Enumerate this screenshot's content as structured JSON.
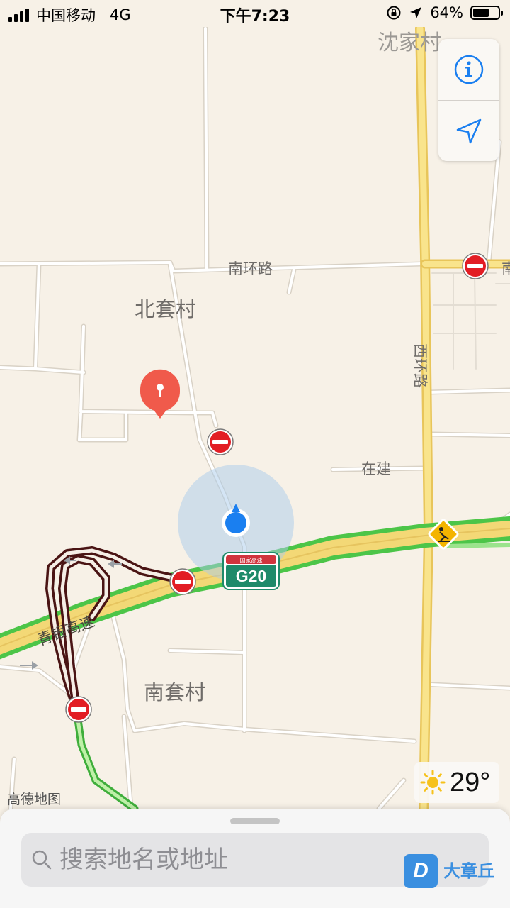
{
  "status_bar": {
    "carrier": "中国移动",
    "network": "4G",
    "time": "下午7:23",
    "battery_percent": "64%",
    "battery_level": 0.64
  },
  "map": {
    "labels": {
      "village_shenjia": "沈家村",
      "nanhuan_road": "南环路",
      "road_edge": "南",
      "village_beitao": "北套村",
      "xihuan_road": "西环路",
      "under_construction": "在建",
      "qingyin_expressway": "青银高速",
      "village_nantao": "南套村"
    },
    "highway_shield": {
      "top_text": "国家高速",
      "route": "G20"
    },
    "colors": {
      "land": "#f7f1e7",
      "expressway_fill": "#f3d876",
      "traffic_green": "#4cc548",
      "congestion_dark": "#4a1414",
      "no_entry_red": "#e21d24",
      "location_blue": "#1a7ff0",
      "marker_red": "#f05a4b"
    },
    "attribution": "高德地图"
  },
  "controls": {
    "info_icon": "info-icon",
    "locate_icon": "location-arrow-icon"
  },
  "weather": {
    "icon": "sun-icon",
    "temperature": "29°"
  },
  "search": {
    "placeholder": "搜索地名或地址"
  },
  "watermark": {
    "logo_letter": "D",
    "text": "大章丘"
  }
}
